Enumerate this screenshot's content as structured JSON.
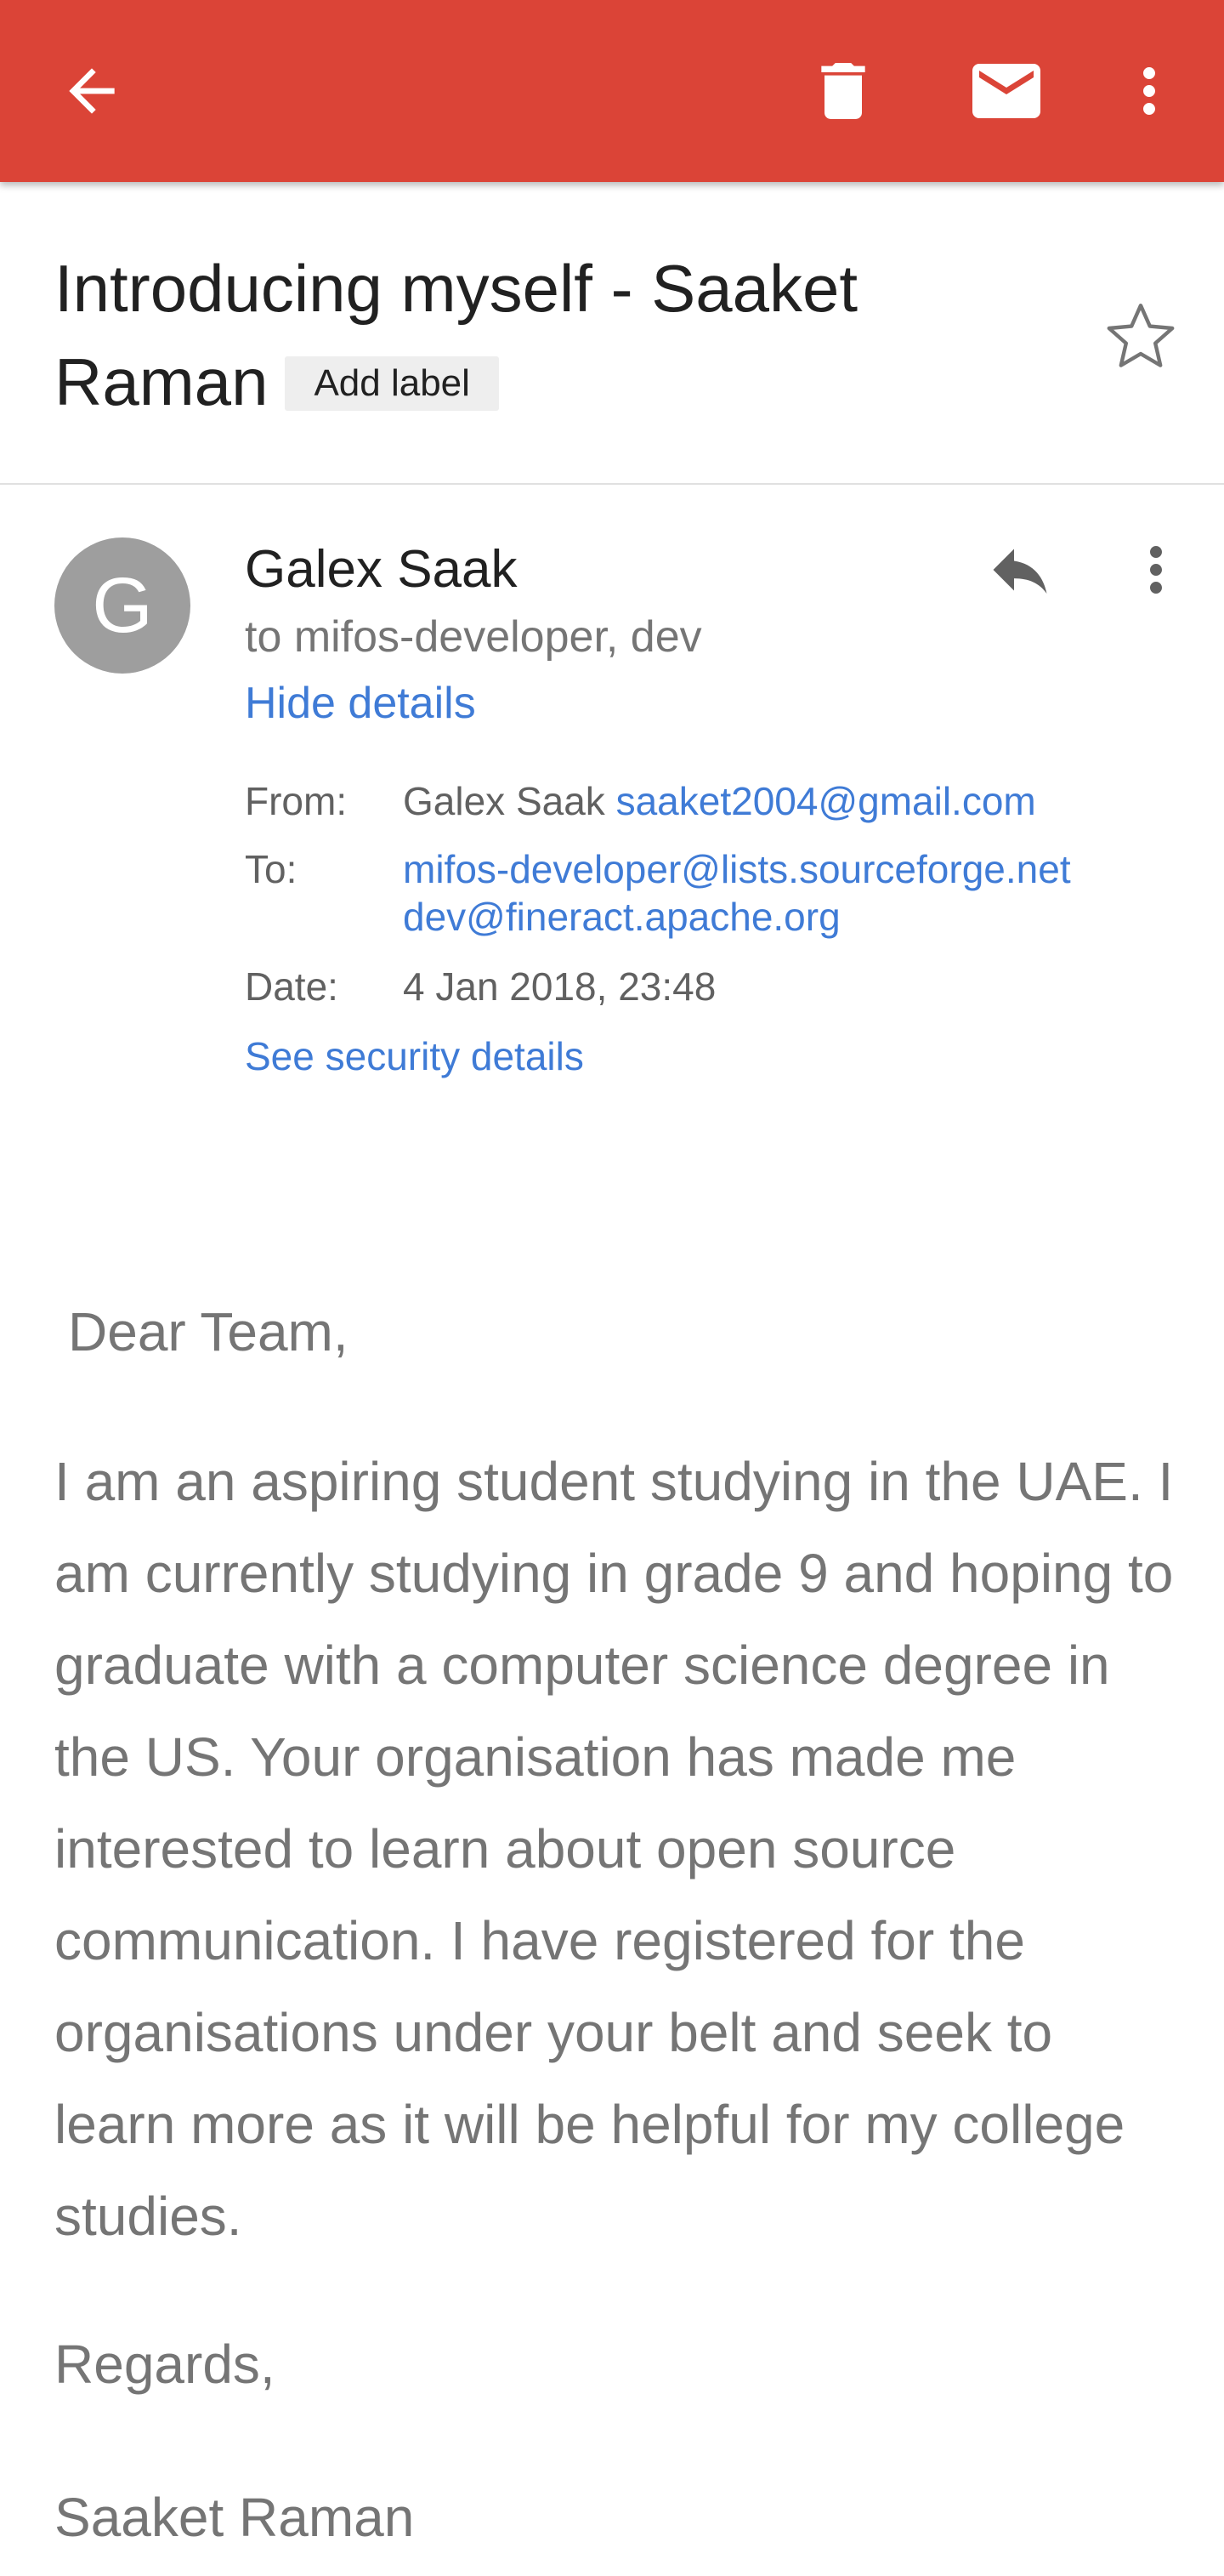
{
  "toolbar": {
    "background": "#db4437",
    "icons": [
      "back-arrow-icon",
      "delete-icon",
      "mail-icon",
      "more-vert-icon"
    ]
  },
  "email": {
    "subject": "Introducing myself - Saaket Raman",
    "add_label": "Add label",
    "star_icon": "star-outline-icon",
    "sender_initial": "G",
    "sender_name": "Galex Saak",
    "recipients_summary": "to mifos-developer, dev",
    "hide_details": "Hide details",
    "details": {
      "from_label": "From:",
      "from_name": "Galex Saak",
      "from_email": "saaket2004@gmail.com",
      "to_label": "To:",
      "to_emails": [
        "mifos-developer@lists.sourceforge.net",
        "dev@fineract.apache.org"
      ],
      "date_label": "Date:",
      "date_value": "4 Jan 2018, 23:48"
    },
    "security_link": "See security details",
    "body": {
      "greeting": "Dear Team,",
      "paragraph": "I am an aspiring student studying in the UAE. I am currently studying in grade 9 and hoping to graduate with a computer science degree in the US. Your organisation has made me interested to learn about open source communication. I have registered for the organisations under your belt and seek to learn more as it will be helpful for my college studies.",
      "regards": "Regards,",
      "signature": "Saaket Raman"
    }
  },
  "colors": {
    "toolbar": "#db4437",
    "link": "#3f7bd6",
    "avatar": "#9e9e9e",
    "body_text": "#757575",
    "title_text": "#212121"
  }
}
